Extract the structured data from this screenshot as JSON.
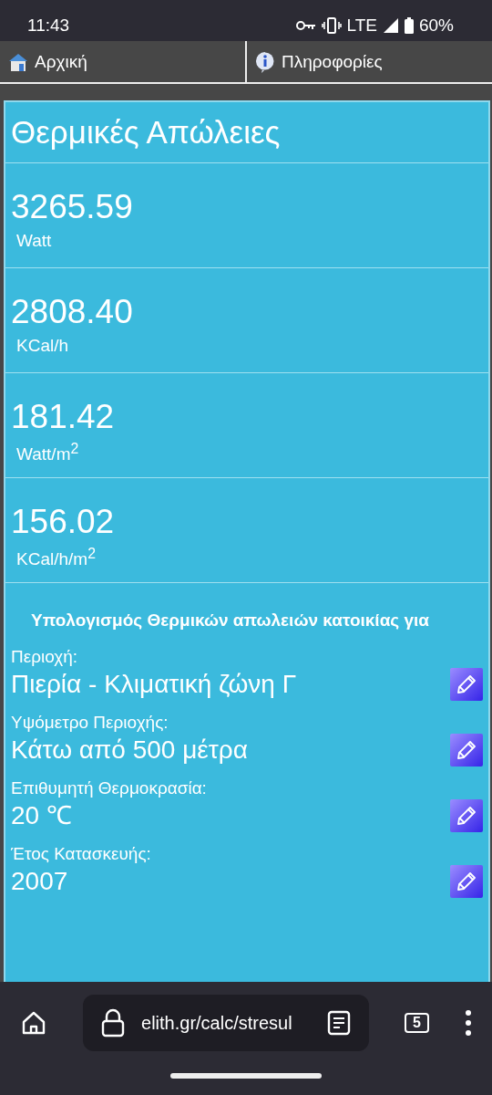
{
  "status_bar": {
    "time": "11:43",
    "network": "LTE",
    "battery": "60%"
  },
  "nav_tabs": [
    {
      "label": "Αρχική"
    },
    {
      "label": "Πληροφορίες"
    }
  ],
  "title": "Θερμικές Απώλειες",
  "results": [
    {
      "value": "3265.59",
      "unit": "Watt"
    },
    {
      "value": "2808.40",
      "unit": "KCal/h"
    },
    {
      "value": "181.42",
      "unit": "Watt/m$^{2}$"
    },
    {
      "value": "156.02",
      "unit": "KCal/h/m$^{2}$"
    }
  ],
  "inputs_heading": "Υπολογισμός Θερμικών απωλειών κατοικίας για",
  "inputs": [
    {
      "label": "Περιοχή:",
      "value": "Πιερία - Κλιματική ζώνη Γ"
    },
    {
      "label": "Υψόμετρο Περιοχής:",
      "value": "Κάτω από 500 μέτρα"
    },
    {
      "label": "Επιθυμητή Θερμοκρασία:",
      "value": "20 ℃"
    },
    {
      "label": "Έτος Κατασκευής:",
      "value": "2007"
    }
  ],
  "browser_bar": {
    "url": "elith.gr/calc/stresul",
    "tab_count": "5"
  }
}
